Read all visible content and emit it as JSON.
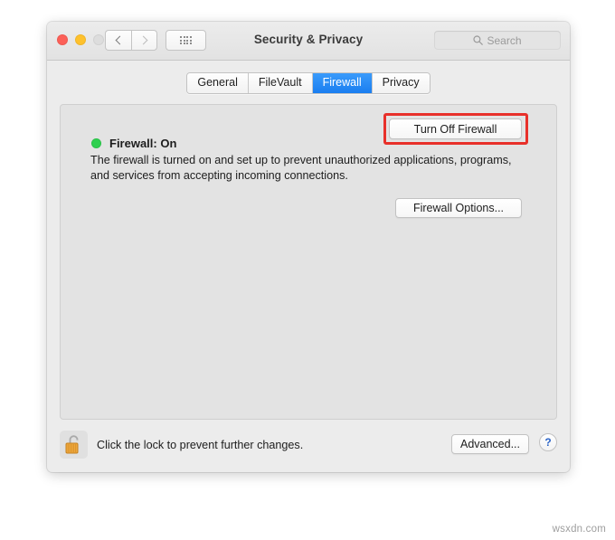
{
  "window": {
    "title": "Security & Privacy",
    "traffic_lights": [
      {
        "name": "close",
        "color": "#fc6058"
      },
      {
        "name": "minimize",
        "color": "#fec12c"
      },
      {
        "name": "zoom",
        "color": "#dddddd"
      }
    ],
    "toolbar": {
      "back_icon": "chevron-left-icon",
      "forward_icon": "chevron-right-icon",
      "grid_icon": "show-all-grid-icon"
    }
  },
  "search": {
    "icon": "search-icon",
    "placeholder": "Search",
    "value": ""
  },
  "tabs": [
    {
      "label": "General",
      "selected": false
    },
    {
      "label": "FileVault",
      "selected": false
    },
    {
      "label": "Firewall",
      "selected": true
    },
    {
      "label": "Privacy",
      "selected": false
    }
  ],
  "firewall": {
    "status_dot_icon": "status-dot-icon",
    "status_dot_color": "#2fd04f",
    "status_label": "Firewall: On",
    "turn_off_label": "Turn Off Firewall",
    "description": "The firewall is turned on and set up to prevent unauthorized applications, programs, and services from accepting incoming connections.",
    "options_label": "Firewall Options..."
  },
  "annotation": {
    "color": "#e8302a",
    "target": "Turn Off Firewall"
  },
  "bottom": {
    "lock_icon": "unlocked-padlock-icon",
    "lock_caption": "Click the lock to prevent further changes.",
    "advanced_label": "Advanced...",
    "help_label": "?"
  },
  "watermark": {
    "text": "wsxdn.com"
  }
}
